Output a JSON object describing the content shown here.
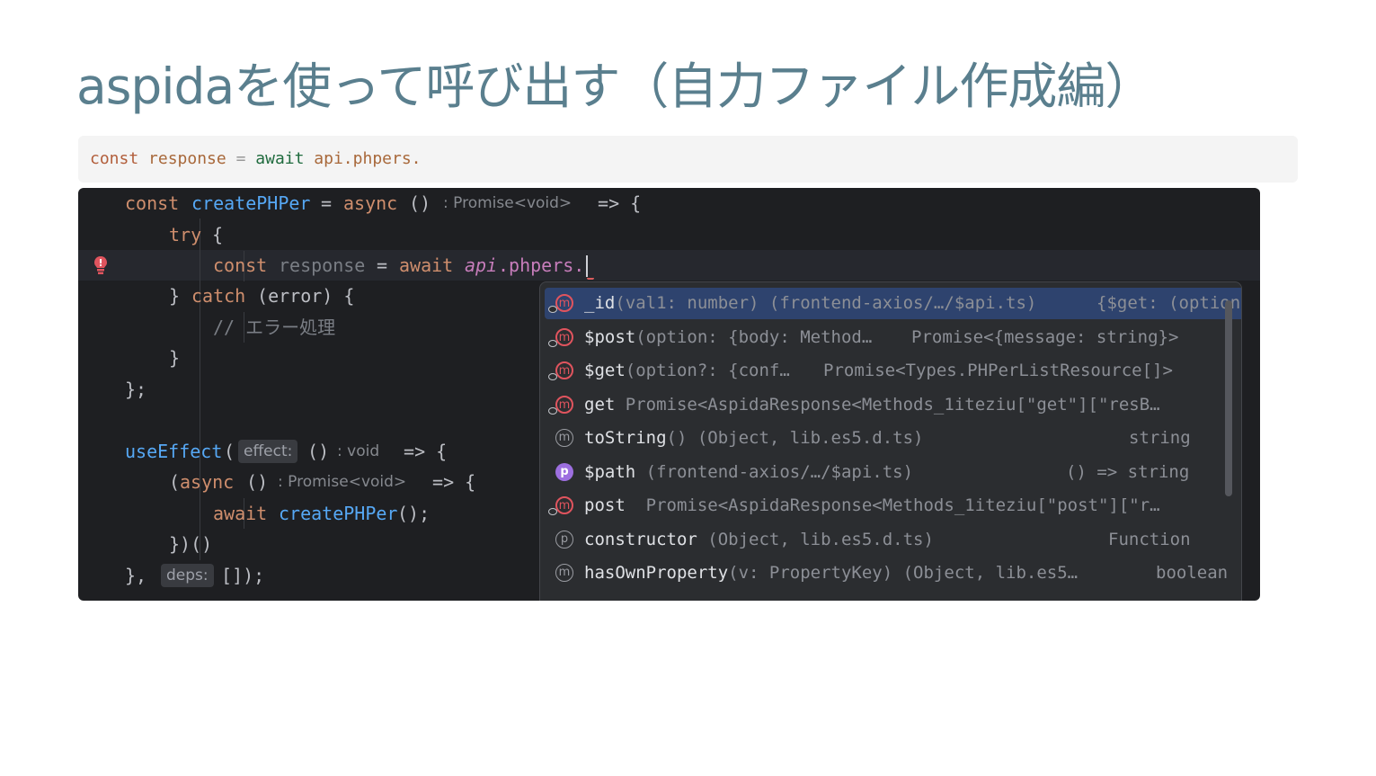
{
  "slide": {
    "title": "aspidaを使って呼び出す（自力ファイル作成編）"
  },
  "snippet": {
    "kw_const": "const",
    "var": "response",
    "eq": "=",
    "kw_await": "await",
    "expr": "api.phpers."
  },
  "editor": {
    "line1": {
      "kw": "const",
      "name": "createPHPer",
      "eq": " = ",
      "kw2": "async",
      "parens": " ()",
      "hint": ": Promise<void>",
      "arrow": " => {"
    },
    "line2": {
      "kw": "try",
      "brace": " {"
    },
    "line3": {
      "kw": "const",
      "var": "response",
      "eq": " = ",
      "kw2": "await",
      "obj": "api",
      "rest": ".phpers."
    },
    "line4": {
      "close": "} ",
      "kw": "catch",
      "rest": " (error) {"
    },
    "line5": {
      "comment": "// エラー処理"
    },
    "line6": {
      "close": "}"
    },
    "line7": {
      "close": "};"
    },
    "line8": {
      "fn": "useEffect",
      "paren": "(",
      "hint": "effect:",
      "parens": " ()",
      "hint2": ": void",
      "arrow": " => {"
    },
    "line9": {
      "open": "(",
      "kw": "async",
      "parens": " ()",
      "hint": ": Promise<void>",
      "arrow": " => {"
    },
    "line10": {
      "kw": "await",
      "fn": "createPHPer",
      "rest": "();"
    },
    "line11": {
      "close": "})()"
    },
    "line12": {
      "close": "}, ",
      "hint": "deps:",
      "rest": " []);"
    }
  },
  "completion": {
    "items": [
      {
        "icon": "m",
        "name": "_id",
        "sig": "(val1: number) (frontend-axios/…/$api.ts)",
        "type": "{$get: (option?"
      },
      {
        "icon": "m",
        "name": "$post",
        "sig": "(option: {body: Method…",
        "type": "Promise<{message: string}>"
      },
      {
        "icon": "m",
        "name": "$get",
        "sig": "(option?: {conf…",
        "type": "Promise<Types.PHPerListResource[]>"
      },
      {
        "icon": "m",
        "name": "get",
        "sig": " Promise<AspidaResponse<Methods_1iteziu[\"get\"][\"resB…",
        "type": ""
      },
      {
        "icon": "m",
        "name": "toString",
        "sig": "() (Object, lib.es5.d.ts)",
        "type": "string"
      },
      {
        "icon": "p",
        "name": "$path",
        "sig": " (frontend-axios/…/$api.ts)",
        "type": "() => string"
      },
      {
        "icon": "m",
        "name": "post",
        "sig": "  Promise<AspidaResponse<Methods_1iteziu[\"post\"][\"r…",
        "type": ""
      },
      {
        "icon": "p",
        "name": "constructor",
        "sig": " (Object, lib.es5.d.ts)",
        "type": "Function"
      },
      {
        "icon": "m",
        "name": "hasOwnProperty",
        "sig": "(v: PropertyKey) (Object, lib.es5…",
        "type": "boolean"
      }
    ]
  },
  "colors": {
    "title": "#5a7f8e",
    "editor_bg": "#1e1f22",
    "popup_bg": "#2b2d30",
    "selection": "#2e436e",
    "keyword": "#cf8e6d",
    "function": "#56a8f5"
  },
  "icons": [
    "bulb-error-icon",
    "method-icon",
    "property-icon",
    "lock-overlay-icon"
  ]
}
